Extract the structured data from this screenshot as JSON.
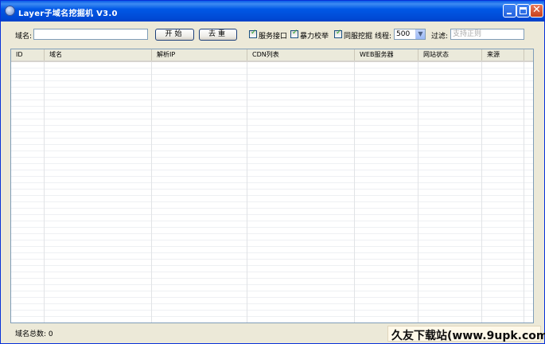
{
  "window": {
    "title": "Layer子域名挖掘机 V3.0"
  },
  "toolbar": {
    "domain_label": "域名:",
    "domain_value": "",
    "start_label": "开始",
    "stop_label": "去重",
    "options": [
      {
        "label": "服务接口",
        "checked": true
      },
      {
        "label": "暴力校举",
        "checked": true
      },
      {
        "label": "同服挖掘",
        "checked": true
      }
    ],
    "threads_label": "线程:",
    "threads_value": "500",
    "filter_label": "过滤:",
    "filter_placeholder": "支持正则"
  },
  "table": {
    "columns": [
      "ID",
      "域名",
      "解析IP",
      "CDN列表",
      "WEB服务器",
      "网站状态",
      "来源"
    ],
    "rows": []
  },
  "status": {
    "total_label": "域名总数:",
    "total_value": "0"
  },
  "watermark": "久友下载站(www.9upk.com)",
  "colors": {
    "titlebar": "#0058e6",
    "window_face": "#ece9d8",
    "check_mark": "#21a121"
  }
}
